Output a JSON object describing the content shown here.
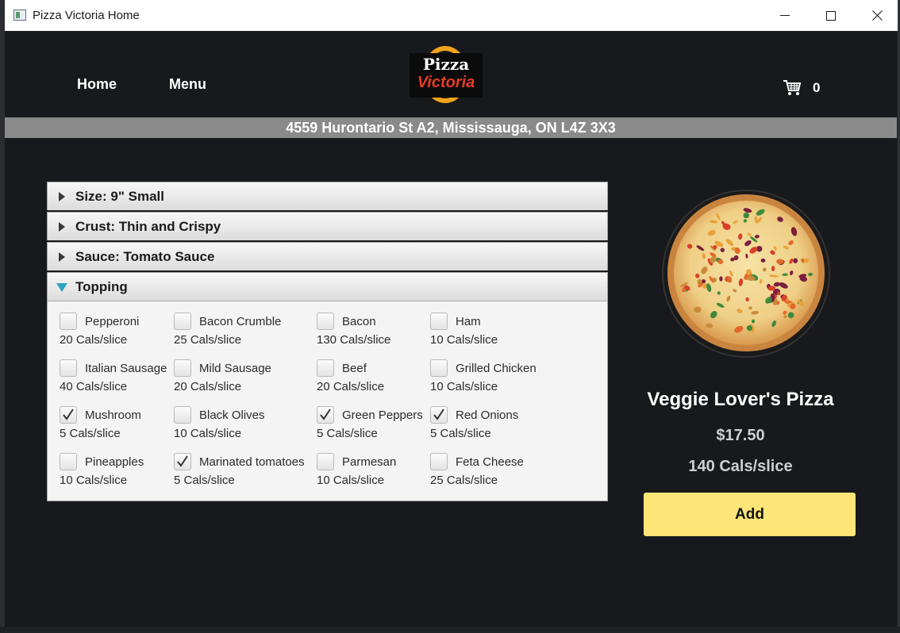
{
  "window": {
    "title": "Pizza Victoria Home"
  },
  "nav": {
    "home": "Home",
    "menu": "Menu"
  },
  "logo": {
    "line1": "Pizza",
    "line2": "Victoria"
  },
  "cart": {
    "count": "0",
    "icon": "cart-icon"
  },
  "address": "4559 Hurontario St A2, Mississauga, ON L4Z 3X3",
  "accordion": {
    "panes": [
      {
        "title": "Size: 9\" Small",
        "expanded": false
      },
      {
        "title": "Crust: Thin and Crispy",
        "expanded": false
      },
      {
        "title": "Sauce: Tomato Sauce",
        "expanded": false
      },
      {
        "title": "Topping",
        "expanded": true
      }
    ]
  },
  "toppings": [
    {
      "name": "Pepperoni",
      "cals": "20 Cals/slice",
      "checked": false
    },
    {
      "name": "Bacon Crumble",
      "cals": "25 Cals/slice",
      "checked": false
    },
    {
      "name": "Bacon",
      "cals": "130 Cals/slice",
      "checked": false
    },
    {
      "name": "Ham",
      "cals": "10 Cals/slice",
      "checked": false
    },
    {
      "name": "Italian Sausage",
      "cals": "40 Cals/slice",
      "checked": false
    },
    {
      "name": "Mild Sausage",
      "cals": "20 Cals/slice",
      "checked": false
    },
    {
      "name": "Beef",
      "cals": "20 Cals/slice",
      "checked": false
    },
    {
      "name": "Grilled Chicken",
      "cals": "10 Cals/slice",
      "checked": false
    },
    {
      "name": "Mushroom",
      "cals": "5 Cals/slice",
      "checked": true
    },
    {
      "name": "Black Olives",
      "cals": "10 Cals/slice",
      "checked": false
    },
    {
      "name": "Green Peppers",
      "cals": "5 Cals/slice",
      "checked": true
    },
    {
      "name": "Red Onions",
      "cals": "5 Cals/slice",
      "checked": true
    },
    {
      "name": "Pineapples",
      "cals": "10 Cals/slice",
      "checked": false
    },
    {
      "name": "Marinated tomatoes",
      "cals": "5 Cals/slice",
      "checked": true
    },
    {
      "name": "Parmesan",
      "cals": "10 Cals/slice",
      "checked": false
    },
    {
      "name": "Feta Cheese",
      "cals": "25 Cals/slice",
      "checked": false
    }
  ],
  "product": {
    "name": "Veggie Lover's Pizza",
    "price": "$17.50",
    "cals": "140 Cals/slice",
    "add_label": "Add"
  },
  "colors": {
    "background": "#17191c",
    "address_bar": "#8a8a8a",
    "add_button": "#fde677",
    "logo_ring": "#f3a31a",
    "logo_red": "#e73b25",
    "accordion_arrow_open": "#2ba3c2"
  }
}
